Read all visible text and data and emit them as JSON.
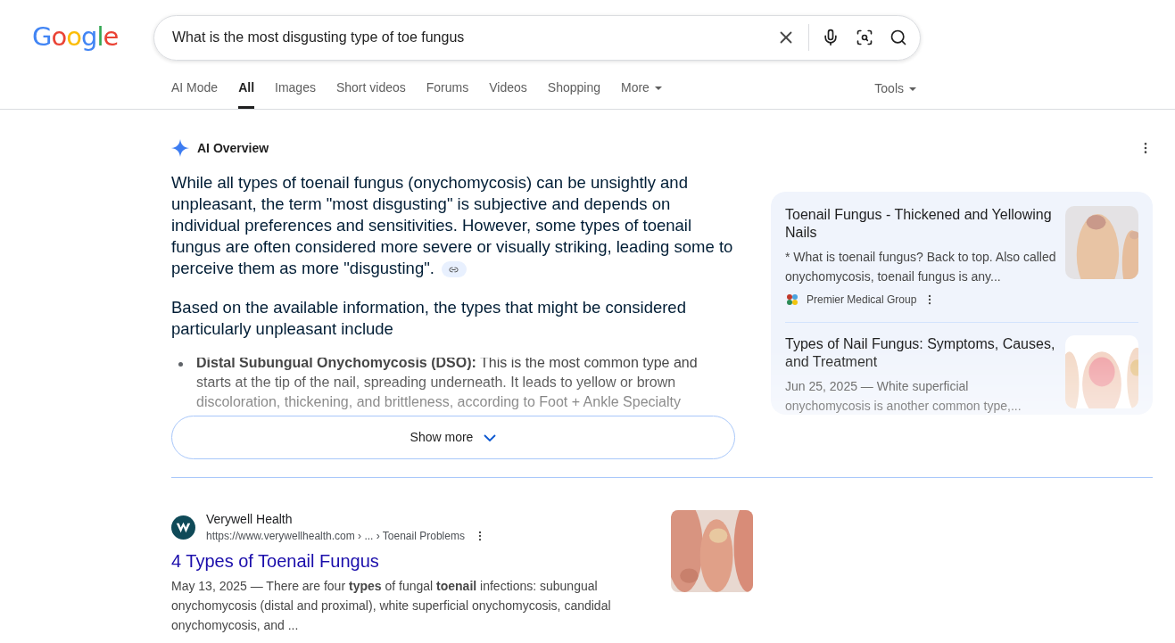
{
  "logo": "Google",
  "search": {
    "value": "What is the most disgusting type of toe fungus"
  },
  "tabs": [
    {
      "label": "AI Mode",
      "selected": false,
      "kind": "plain"
    },
    {
      "label": "All",
      "selected": true,
      "kind": "plain"
    },
    {
      "label": "Images",
      "selected": false,
      "kind": "plain"
    },
    {
      "label": "Short videos",
      "selected": false,
      "kind": "plain"
    },
    {
      "label": "Forums",
      "selected": false,
      "kind": "plain"
    },
    {
      "label": "Videos",
      "selected": false,
      "kind": "plain"
    },
    {
      "label": "Shopping",
      "selected": false,
      "kind": "plain"
    },
    {
      "label": "More",
      "selected": false,
      "kind": "menu"
    }
  ],
  "tools": "Tools",
  "ai_overview": {
    "title": "AI Overview",
    "paragraphs": [
      "While all types of toenail fungus (onychomycosis) can be unsightly and unpleasant, the term \"most disgusting\" is subjective and depends on individual preferences and sensitivities. However, some types of toenail fungus are often considered more severe or visually striking, leading some to perceive them as more \"disgusting\".",
      "Based on the available information, the types that might be considered particularly unpleasant include"
    ],
    "bullets": [
      "**Distal Subungual Onychomycosis (DSO):** This is the most common type and starts at the tip of the nail, spreading underneath. It leads to yellow or brown discoloration, thickening, and brittleness, according to Foot + Ankle Specialty"
    ],
    "show_more": "Show more",
    "sources": [
      {
        "title": "Toenail Fungus - Thickened and Yellowing Nails",
        "snippet": "* What is toenail fungus? Back to top. Also called onychomycosis, toenail fungus is any...",
        "site": "Premier Medical Group"
      },
      {
        "title": "Types of Nail Fungus: Symptoms, Causes, and Treatment",
        "snippet": "Jun 25, 2025 — White superficial onychomycosis is another common type,..."
      }
    ]
  },
  "results": [
    {
      "site": "Verywell Health",
      "url": "https://www.verywellhealth.com › ... › Toenail Problems",
      "title": "4 Types of Toenail Fungus",
      "snippet": "May 13, 2025 — There are four **types** of fungal **toenail** infections: subungual onychomycosis (distal and proximal), white superficial onychomycosis, candidal onychomycosis, and ..."
    }
  ]
}
